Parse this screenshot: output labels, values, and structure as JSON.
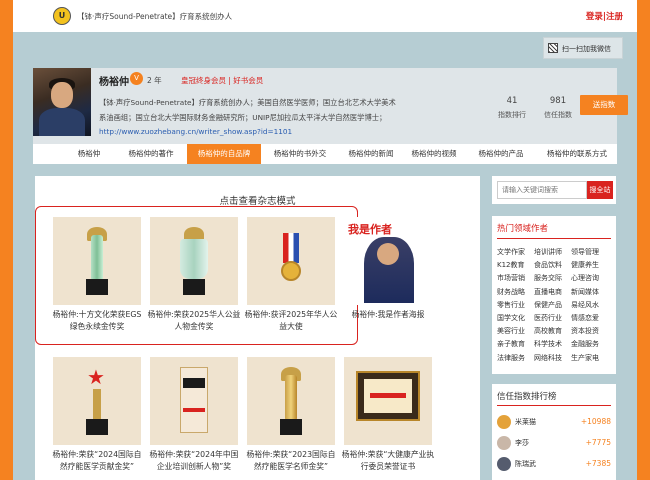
{
  "header": {
    "logo_text": "U",
    "site_title": "【钵·声疗Sound-Penetrate】疗育系统创办人",
    "login": "登录",
    "separator": " | ",
    "register": "注册"
  },
  "wechat": {
    "label": "扫一扫加我微信"
  },
  "profile": {
    "name": "杨裕仲",
    "vip_badge": "V",
    "years": "2 年",
    "tags": "皇冠终身会员 | 好书会员",
    "bio": "【钵·声疗Sound-Penetrate】疗育系统创办人；美国自然医学医师；国立台北艺术大学美术系油画组；国立台北大学国际财务金融研究所；UNIP尼加拉瓜太平洋大学自然医学博士；",
    "url": "http://www.zuozhebang.cn/writer_show.asp?id=1101",
    "stats": [
      {
        "value": "41",
        "label": "指数排行"
      },
      {
        "value": "981",
        "label": "信任指数"
      }
    ],
    "gift_button": "送指数"
  },
  "nav": {
    "items": [
      {
        "label": "杨裕仲"
      },
      {
        "label": "杨裕仲的著作"
      },
      {
        "label": "杨裕仲的自品牌"
      },
      {
        "label": "杨裕仲的书外交"
      },
      {
        "label": "杨裕仲的新闻"
      },
      {
        "label": "杨裕仲的视频"
      },
      {
        "label": "杨裕仲的产品"
      },
      {
        "label": "杨裕仲的联系方式"
      }
    ],
    "active_index": 2
  },
  "main": {
    "magazine_link": "点击查看杂志模式",
    "cards": [
      {
        "caption": "杨裕仲:十方文化荣获EGS绿色永续金传奖"
      },
      {
        "caption": "杨裕仲:荣获2025华人公益人物金传奖"
      },
      {
        "caption": "杨裕仲:获评2025年华人公益大使"
      },
      {
        "caption": "杨裕仲:我是作者海报",
        "poster_text": "我是作者"
      },
      {
        "caption": "杨裕仲:荣获“2024国际自然疗能医学贡献金奖”"
      },
      {
        "caption": "杨裕仲:荣获“2024年中国企业培训创新人物”奖"
      },
      {
        "caption": "杨裕仲:荣获“2023国际自然疗能医学名师金奖”"
      },
      {
        "caption": "杨裕仲:荣获“大健康产业执行委员荣誉证书"
      }
    ]
  },
  "sidebar": {
    "search_placeholder": "请输入关键词搜索",
    "search_button": "搜全站",
    "hot_title": "热门领域作者",
    "hot_fields": [
      "文学作家",
      "培训讲师",
      "领导管理",
      "K12教育",
      "食品饮料",
      "健康养生",
      "市场营销",
      "服务交际",
      "心理咨询",
      "财务战略",
      "直播电商",
      "新闻媒体",
      "零售行业",
      "保健产品",
      "易经风水",
      "国学文化",
      "医药行业",
      "情感恋爱",
      "美容行业",
      "高校教育",
      "资本投资",
      "亲子教育",
      "科学技术",
      "金融服务",
      "法律服务",
      "网络科技",
      "生产家电"
    ],
    "rank_title": "信任指数排行榜",
    "rank": [
      {
        "name": "米莱猫",
        "score": "+10988",
        "color": "#e4a23a"
      },
      {
        "name": "李莎",
        "score": "+7775",
        "color": "#c9b7a8"
      },
      {
        "name": "陈瑞武",
        "score": "+7385",
        "color": "#555c6e"
      }
    ]
  }
}
